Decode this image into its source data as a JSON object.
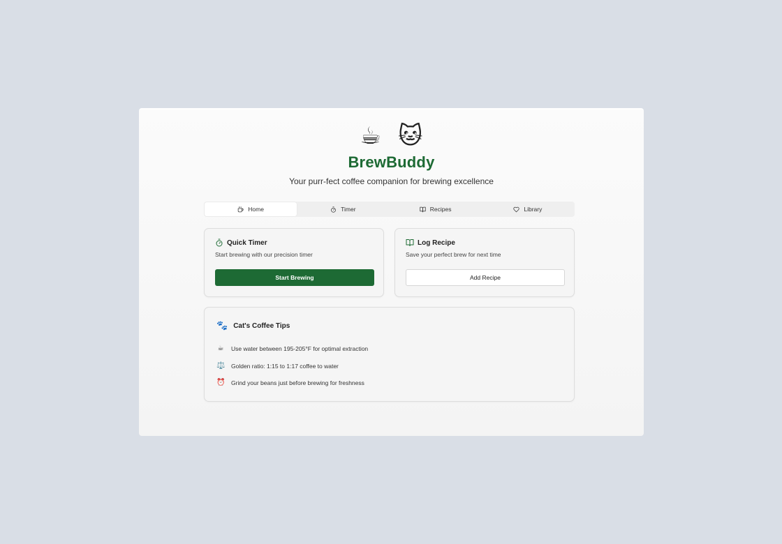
{
  "app": {
    "icons": [
      "☕",
      "🐱"
    ],
    "title": "BrewBuddy",
    "subtitle": "Your purr-fect coffee companion for brewing excellence"
  },
  "tabs": [
    {
      "label": "Home",
      "icon": "coffee-cup-icon",
      "active": true
    },
    {
      "label": "Timer",
      "icon": "stopwatch-icon",
      "active": false
    },
    {
      "label": "Recipes",
      "icon": "book-icon",
      "active": false
    },
    {
      "label": "Library",
      "icon": "heart-icon",
      "active": false
    }
  ],
  "quick_timer": {
    "title": "Quick Timer",
    "description": "Start brewing with our precision timer",
    "button": "Start Brewing"
  },
  "log_recipe": {
    "title": "Log Recipe",
    "description": "Save your perfect brew for next time",
    "button": "Add Recipe"
  },
  "tips": {
    "icon": "🐾",
    "title": "Cat's Coffee Tips",
    "items": [
      {
        "emoji": "☕",
        "text": "Use water between 195-205°F for optimal extraction"
      },
      {
        "emoji": "⚖️",
        "text": "Golden ratio: 1:15 to 1:17 coffee to water"
      },
      {
        "emoji": "⏰",
        "text": "Grind your beans just before brewing for freshness"
      }
    ]
  },
  "colors": {
    "accent": "#1d6a34",
    "background": "#d9dee6"
  }
}
